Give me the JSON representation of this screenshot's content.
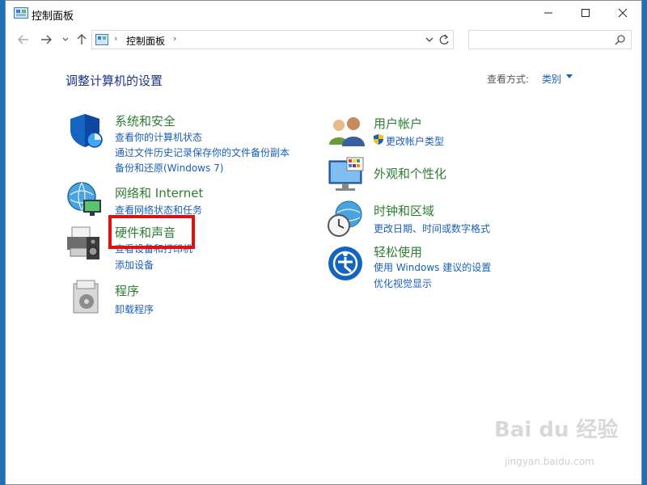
{
  "window": {
    "title": "控制面板"
  },
  "address": {
    "path": "控制面板"
  },
  "search": {
    "placeholder": ""
  },
  "content": {
    "heading": "调整计算机的设置",
    "view_by_label": "查看方式:",
    "view_by_value": "类别"
  },
  "categories": {
    "system": {
      "title": "系统和安全",
      "links": [
        "查看你的计算机状态",
        "通过文件历史记录保存你的文件备份副本",
        "备份和还原(Windows 7)"
      ]
    },
    "network": {
      "title": "网络和 Internet",
      "links": [
        "查看网络状态和任务"
      ]
    },
    "hardware": {
      "title": "硬件和声音",
      "links": [
        "查看设备和打印机",
        "添加设备"
      ]
    },
    "programs": {
      "title": "程序",
      "links": [
        "卸载程序"
      ]
    },
    "users": {
      "title": "用户帐户",
      "links": [
        "更改帐户类型"
      ]
    },
    "appearance": {
      "title": "外观和个性化",
      "links": []
    },
    "clock": {
      "title": "时钟和区域",
      "links": [
        "更改日期、时间或数字格式"
      ]
    },
    "ease": {
      "title": "轻松使用",
      "links": [
        "使用 Windows 建议的设置",
        "优化视觉显示"
      ]
    }
  },
  "watermark": {
    "brand": "Bai du 经验",
    "url": "jingyan.baidu.com"
  }
}
